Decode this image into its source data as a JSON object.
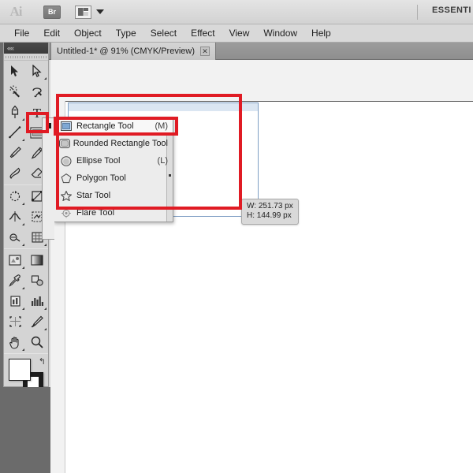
{
  "app": {
    "name": "Adobe Illustrator",
    "logo_text": "Ai",
    "bridge_label": "Br",
    "arrange_label": "arrange-documents",
    "workspace": "ESSENTI"
  },
  "menubar": {
    "items": [
      {
        "label": "File"
      },
      {
        "label": "Edit"
      },
      {
        "label": "Object"
      },
      {
        "label": "Type"
      },
      {
        "label": "Select"
      },
      {
        "label": "Effect"
      },
      {
        "label": "View"
      },
      {
        "label": "Window"
      },
      {
        "label": "Help"
      }
    ]
  },
  "tabs": [
    {
      "title": "Untitled-1* @ 91% (CMYK/Preview)",
      "close": "✕",
      "active": true
    }
  ],
  "tools": {
    "panel_collapse": "««",
    "rows": [
      [
        {
          "name": "selection-tool",
          "corner": false
        },
        {
          "name": "direct-selection-tool",
          "corner": true
        }
      ],
      [
        {
          "name": "magic-wand-tool",
          "corner": false
        },
        {
          "name": "lasso-tool",
          "corner": false
        }
      ],
      [
        {
          "name": "pen-tool",
          "corner": true
        },
        {
          "name": "type-tool",
          "corner": true
        }
      ],
      [
        {
          "name": "line-segment-tool",
          "corner": true
        },
        {
          "name": "rectangle-tool",
          "corner": true,
          "selected": true
        }
      ],
      [
        {
          "name": "paintbrush-tool",
          "corner": false
        },
        {
          "name": "pencil-tool",
          "corner": true
        }
      ],
      [
        {
          "name": "blob-brush-tool",
          "corner": false
        },
        {
          "name": "eraser-tool",
          "corner": true
        }
      ],
      [
        {
          "name": "rotate-tool",
          "corner": true
        },
        {
          "name": "scale-tool",
          "corner": true
        }
      ],
      [
        {
          "name": "width-tool",
          "corner": true
        },
        {
          "name": "shape-builder-tool",
          "corner": true
        }
      ],
      [
        {
          "name": "perspective-grid-tool",
          "corner": true
        },
        {
          "name": "mesh-tool",
          "corner": true
        }
      ],
      [
        {
          "name": "symbol-sprayer-tool",
          "corner": true
        },
        {
          "name": "gradient-tool",
          "corner": false
        }
      ],
      [
        {
          "name": "eyedropper-tool",
          "corner": true
        },
        {
          "name": "blend-tool",
          "corner": false
        }
      ],
      [
        {
          "name": "column-graph-tool",
          "corner": true
        },
        {
          "name": "bar-graph-tool",
          "corner": true
        }
      ],
      [
        {
          "name": "artboard-tool",
          "corner": false
        },
        {
          "name": "slice-tool",
          "corner": true
        }
      ],
      [
        {
          "name": "hand-tool",
          "corner": true
        },
        {
          "name": "zoom-tool",
          "corner": false
        }
      ]
    ],
    "fill_stroke": {
      "fill_color": "#ffffff",
      "stroke_color": "#1c1c1c",
      "swap_icon": "↰",
      "default_label": "default-fill-and-stroke"
    },
    "color_modes": [
      {
        "name": "color-mode-color",
        "selected": true
      },
      {
        "name": "color-mode-gradient",
        "selected": false
      },
      {
        "name": "color-mode-none",
        "selected": false
      }
    ],
    "draw_modes": [
      {
        "name": "draw-normal",
        "selected": true
      },
      {
        "name": "draw-behind",
        "selected": false
      },
      {
        "name": "draw-inside",
        "selected": false
      }
    ],
    "screen_mode": {
      "name": "change-screen-mode"
    }
  },
  "flyout": {
    "title": "shape-tools-flyout",
    "tearoff_marker": "tear-off-handle",
    "items": [
      {
        "label": "Rectangle Tool",
        "shortcut": "(M)",
        "icon": "rectangle-icon",
        "active": true
      },
      {
        "label": "Rounded Rectangle Tool",
        "shortcut": "",
        "icon": "rounded-rectangle-icon",
        "active": false
      },
      {
        "label": "Ellipse Tool",
        "shortcut": "(L)",
        "icon": "ellipse-icon",
        "active": false
      },
      {
        "label": "Polygon Tool",
        "shortcut": "",
        "icon": "polygon-icon",
        "active": false
      },
      {
        "label": "Star Tool",
        "shortcut": "",
        "icon": "star-icon",
        "active": false
      },
      {
        "label": "Flare Tool",
        "shortcut": "",
        "icon": "flare-icon",
        "active": false
      }
    ]
  },
  "canvas": {
    "measure_tooltip": {
      "width_text": "W: 251.73 px",
      "height_text": "H: 144.99 px"
    },
    "selection": {
      "name": "live-rectangle-preview"
    }
  },
  "annotations": {
    "accent_color": "#e01b24",
    "boxes": [
      {
        "name": "annotation-canvas-rect"
      },
      {
        "name": "annotation-rectangle-tool"
      },
      {
        "name": "annotation-rectangle-menu-item"
      }
    ]
  }
}
